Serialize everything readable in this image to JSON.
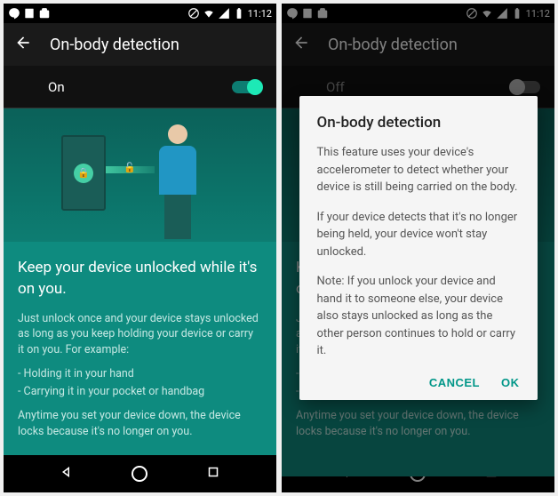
{
  "status": {
    "time": "11:12"
  },
  "left": {
    "title": "On-body detection",
    "toggleLabel": "On",
    "heading": "Keep your device unlocked while it's on you.",
    "p1": "Just unlock once and your device stays unlocked as long as you keep holding your device or carry it on you. For example:",
    "b1": "- Holding it in your hand",
    "b2": "- Carrying it in your pocket or handbag",
    "p2": "Anytime you set your device down, the device locks because it's no longer on you."
  },
  "right": {
    "title": "On-body detection",
    "toggleLabel": "Off",
    "dialog": {
      "title": "On-body detection",
      "p1": "This feature uses your device's accelerometer to detect whether your device is still being carried on the body.",
      "p2": "If your device detects that it's no longer being held, your device won't stay unlocked.",
      "p3": "Note: If you unlock your device and hand it to someone else, your device also stays unlocked as long as the other person continues to hold or carry it.",
      "cancel": "CANCEL",
      "ok": "OK"
    }
  },
  "colors": {
    "accent": "#009688",
    "toggleOn": "#1de9b6"
  }
}
